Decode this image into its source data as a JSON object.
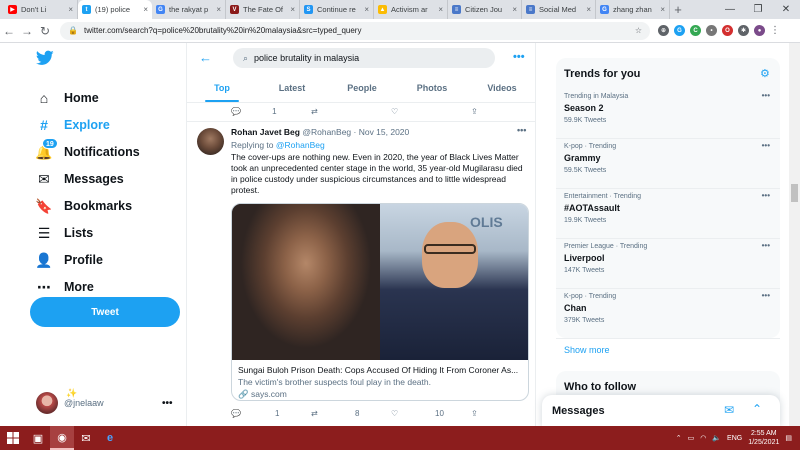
{
  "browser": {
    "tabs": [
      {
        "label": "Don't Li",
        "favcolor": "#ff0000",
        "favtext": "▶"
      },
      {
        "label": "(19) police",
        "favcolor": "#1da1f2",
        "favtext": "t",
        "active": true
      },
      {
        "label": "the rakyat p",
        "favcolor": "#4285f4",
        "favtext": "G"
      },
      {
        "label": "The Fate Of",
        "favcolor": "#8b1a1a",
        "favtext": "V"
      },
      {
        "label": "Continue re",
        "favcolor": "#2196f3",
        "favtext": "S"
      },
      {
        "label": "Activism ar",
        "favcolor": "#fbbc04",
        "favtext": "▲"
      },
      {
        "label": "Citizen Jou",
        "favcolor": "#4a78c9",
        "favtext": "≡"
      },
      {
        "label": "Social Med",
        "favcolor": "#4a78c9",
        "favtext": "≡"
      },
      {
        "label": "zhang zhan",
        "favcolor": "#4285f4",
        "favtext": "G"
      }
    ],
    "newtab": "+",
    "url": "twitter.com/search?q=police%20brutality%20in%20malaysia&src=typed_query"
  },
  "nav": {
    "items": [
      {
        "label": "Home",
        "icon": "⌂"
      },
      {
        "label": "Explore",
        "icon": "#"
      },
      {
        "label": "Notifications",
        "icon": "🔔",
        "badge": "19"
      },
      {
        "label": "Messages",
        "icon": "✉"
      },
      {
        "label": "Bookmarks",
        "icon": "🔖"
      },
      {
        "label": "Lists",
        "icon": "☰"
      },
      {
        "label": "Profile",
        "icon": "👤"
      },
      {
        "label": "More",
        "icon": "⋯"
      }
    ],
    "tweet_button": "Tweet",
    "account_handle": "@jnelaaw",
    "account_emoji": "✨",
    "account_more": "•••"
  },
  "search": {
    "query": "police brutality in malaysia",
    "more": "•••",
    "tabs": [
      "Top",
      "Latest",
      "People",
      "Photos",
      "Videos"
    ]
  },
  "prev_tweet": {
    "replies": "1"
  },
  "tweet": {
    "name": "Rohan Javet Beg",
    "handle": "@RohanBeg · Nov 15, 2020",
    "replying_prefix": "Replying to ",
    "replying_to": "@RohanBeg",
    "body": "The cover-ups are nothing new. Even in 2020, the year of Black Lives Matter took an unprecedented center stage in the world, 35 year-old Mugilarasu died in police custody under suspicious circumstances and to little widespread protest.",
    "card": {
      "title": "Sungai Buloh Prison Death: Cops Accused Of Hiding It From Coroner As...",
      "description": "The victim's brother suspects foul play in the death.",
      "domain": "says.com",
      "sign_text": "OLIS"
    },
    "replies": "1",
    "retweets": "8",
    "likes": "10"
  },
  "trends": {
    "title": "Trends for you",
    "items": [
      {
        "context": "Trending in Malaysia",
        "name": "Season 2",
        "count": "59.9K Tweets"
      },
      {
        "context": "K-pop · Trending",
        "name": "Grammy",
        "count": "59.5K Tweets"
      },
      {
        "context": "Entertainment · Trending",
        "name": "#AOTAssault",
        "count": "19.9K Tweets"
      },
      {
        "context": "Premier League · Trending",
        "name": "Liverpool",
        "count": "147K Tweets"
      },
      {
        "context": "K-pop · Trending",
        "name": "Chan",
        "count": "379K Tweets"
      }
    ],
    "show_more": "Show more"
  },
  "who_to_follow": {
    "title": "Who to follow"
  },
  "messages": {
    "title": "Messages"
  },
  "taskbar": {
    "time": "2:55 AM",
    "date": "1/25/2021",
    "lang": "ENG"
  },
  "colors": {
    "accent": "#1da1f2",
    "taskbar": "#8c1d1d"
  }
}
